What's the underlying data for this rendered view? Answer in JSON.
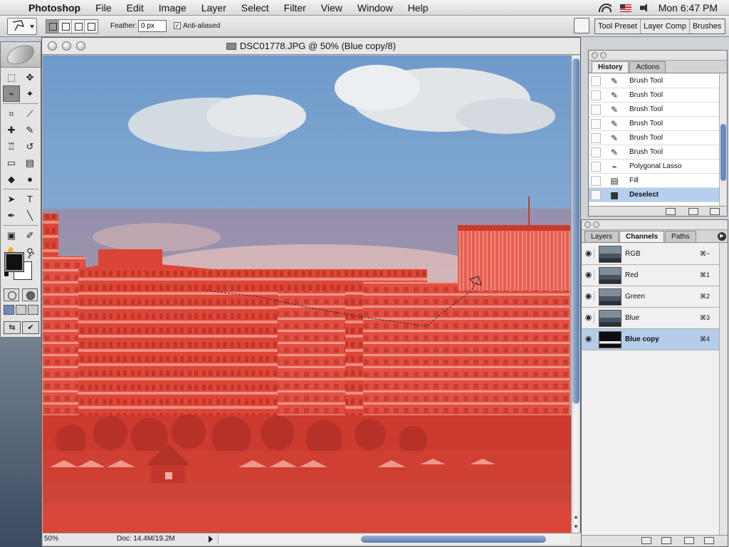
{
  "menubar": {
    "app": "Photoshop",
    "items": [
      "File",
      "Edit",
      "Image",
      "Layer",
      "Select",
      "Filter",
      "View",
      "Window",
      "Help"
    ],
    "clock": "Mon 6:47 PM"
  },
  "options": {
    "feather_label": "Feather:",
    "feather_value": "0 px",
    "antialias_checked": true,
    "antialias_label": "Anti-aliased"
  },
  "palette_well": [
    "Tool Preset",
    "Layer Comp",
    "Brushes"
  ],
  "toolbox": {
    "tools": [
      {
        "name": "rectangular-marquee-tool-icon",
        "glyph": "⬚"
      },
      {
        "name": "move-tool-icon",
        "glyph": "✥"
      },
      {
        "name": "polygonal-lasso-tool-icon",
        "glyph": "⌁",
        "active": true
      },
      {
        "name": "magic-wand-tool-icon",
        "glyph": "✦"
      },
      {
        "name": "crop-tool-icon",
        "glyph": "⌗"
      },
      {
        "name": "slice-tool-icon",
        "glyph": "⟋"
      },
      {
        "name": "healing-brush-tool-icon",
        "glyph": "✚"
      },
      {
        "name": "brush-tool-icon",
        "glyph": "✎"
      },
      {
        "name": "clone-stamp-tool-icon",
        "glyph": "♖"
      },
      {
        "name": "history-brush-tool-icon",
        "glyph": "↺"
      },
      {
        "name": "eraser-tool-icon",
        "glyph": "▭"
      },
      {
        "name": "gradient-tool-icon",
        "glyph": "▤"
      },
      {
        "name": "blur-tool-icon",
        "glyph": "◆"
      },
      {
        "name": "dodge-tool-icon",
        "glyph": "●"
      },
      {
        "name": "path-selection-tool-icon",
        "glyph": "➤"
      },
      {
        "name": "type-tool-icon",
        "glyph": "T"
      },
      {
        "name": "pen-tool-icon",
        "glyph": "✒"
      },
      {
        "name": "line-tool-icon",
        "glyph": "╲"
      },
      {
        "name": "notes-tool-icon",
        "glyph": "▣"
      },
      {
        "name": "eyedropper-tool-icon",
        "glyph": "✐"
      },
      {
        "name": "hand-tool-icon",
        "glyph": "✋"
      },
      {
        "name": "zoom-tool-icon",
        "glyph": "⚲"
      }
    ],
    "foreground_color": "#111111",
    "background_color": "#ffffff"
  },
  "document": {
    "title": "DSC01778.JPG @ 50% (Blue copy/8)",
    "zoom": "50%",
    "doc_size": "Doc: 14.4M/19.2M"
  },
  "history": {
    "tabs": [
      "History",
      "Actions"
    ],
    "items": [
      {
        "label": "Brush Tool",
        "icon": "brush-icon"
      },
      {
        "label": "Brush Tool",
        "icon": "brush-icon"
      },
      {
        "label": "Brush Tool",
        "icon": "brush-icon"
      },
      {
        "label": "Brush Tool",
        "icon": "brush-icon"
      },
      {
        "label": "Brush Tool",
        "icon": "brush-icon"
      },
      {
        "label": "Brush Tool",
        "icon": "brush-icon"
      },
      {
        "label": "Polygonal Lasso",
        "icon": "lasso-icon"
      },
      {
        "label": "Fill",
        "icon": "fill-icon"
      },
      {
        "label": "Deselect",
        "icon": "deselect-icon",
        "selected": true
      }
    ]
  },
  "channels": {
    "tabs": [
      "Layers",
      "Channels",
      "Paths"
    ],
    "rows": [
      {
        "name": "RGB",
        "shortcut": "⌘~"
      },
      {
        "name": "Red",
        "shortcut": "⌘1"
      },
      {
        "name": "Green",
        "shortcut": "⌘2"
      },
      {
        "name": "Blue",
        "shortcut": "⌘3"
      },
      {
        "name": "Blue copy",
        "shortcut": "⌘4",
        "selected": true
      }
    ]
  },
  "colors": {
    "sky_top": "#7aa4cf",
    "quick_mask_overlay": "#e23a2a",
    "selection_highlight": "#b5d0ee"
  }
}
